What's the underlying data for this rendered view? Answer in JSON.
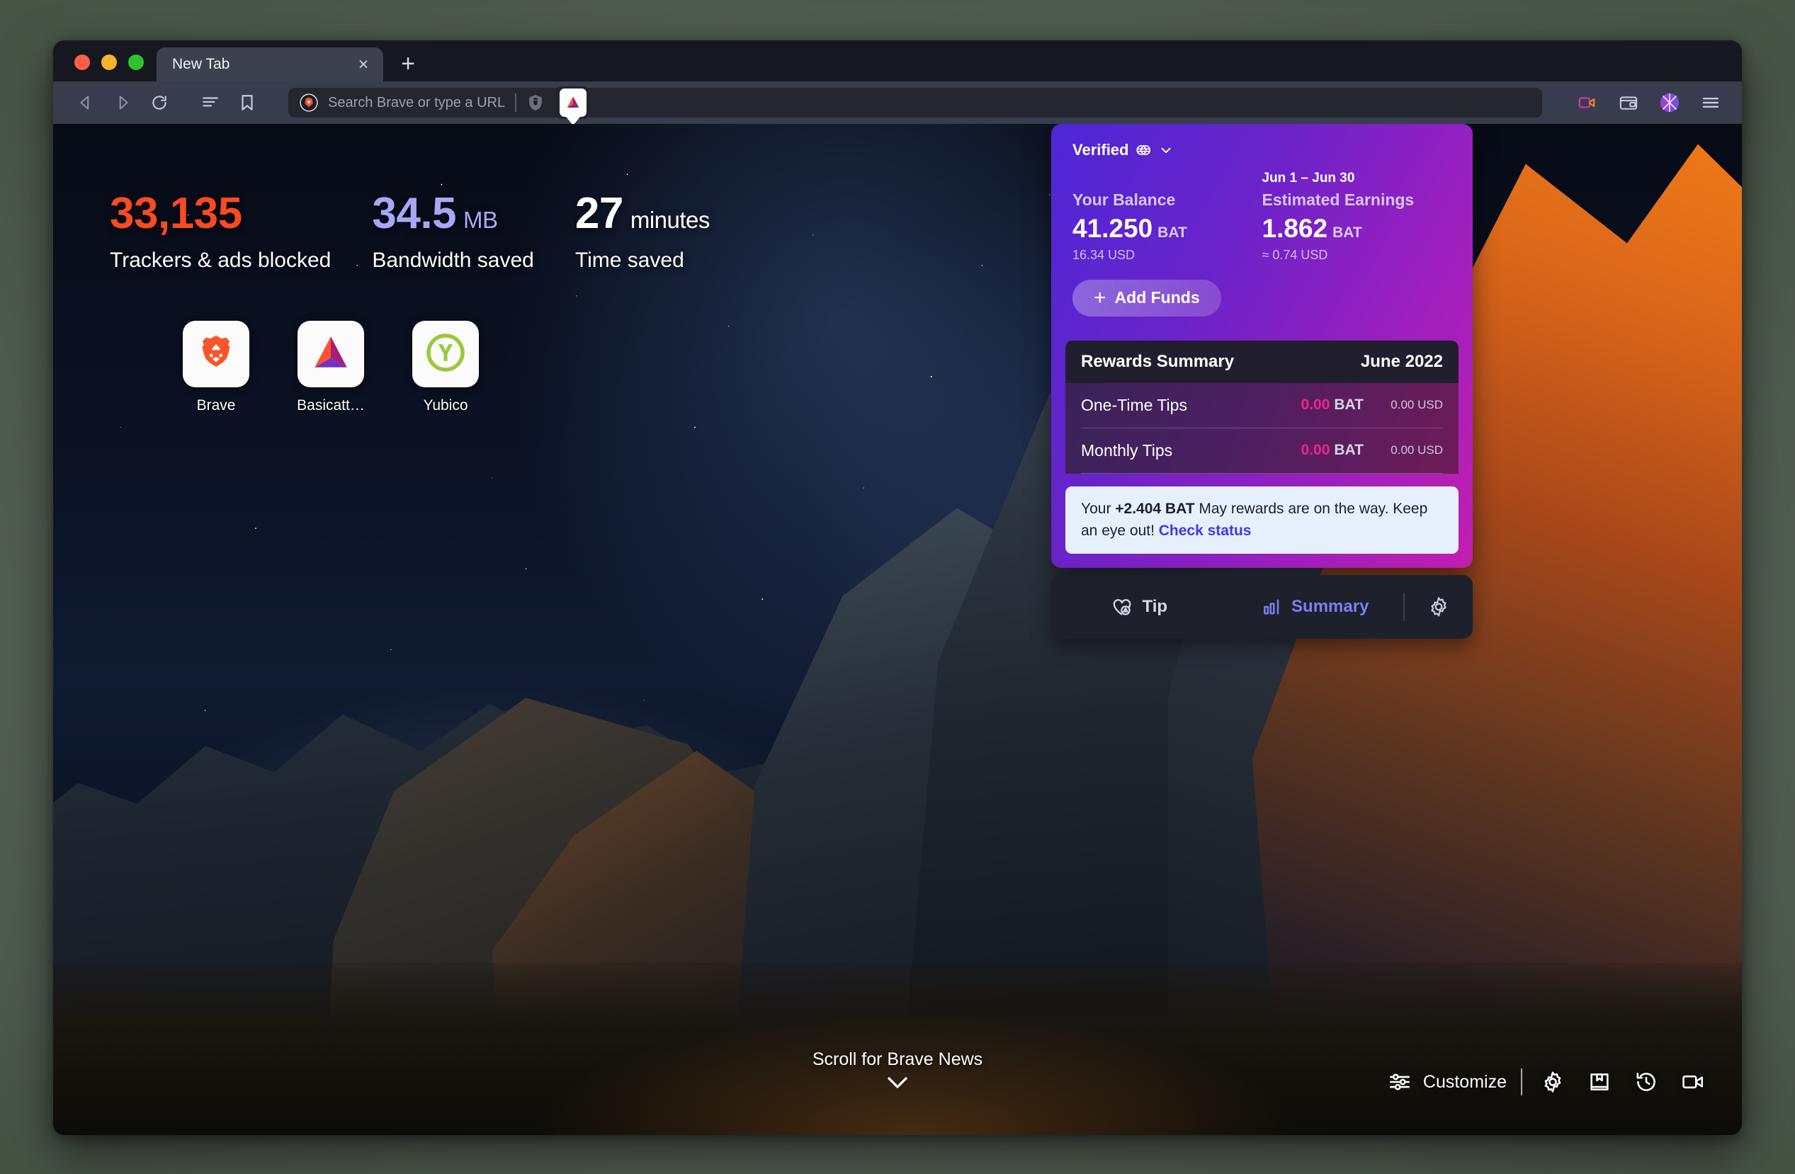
{
  "window": {
    "traffic_lights": [
      "close",
      "minimize",
      "zoom"
    ]
  },
  "tabs": {
    "items": [
      {
        "title": "New Tab",
        "close_label": "×"
      }
    ],
    "new_tab_label": "+"
  },
  "toolbar": {
    "back_icon": "back-arrow-icon",
    "forward_icon": "forward-arrow-icon",
    "reload_icon": "reload-icon",
    "reading_list_icon": "reading-list-icon",
    "bookmark_icon": "bookmark-icon",
    "omnibox": {
      "placeholder": "Search Brave or type a URL",
      "leading_icon": "brave-search-lion-icon",
      "shields_icon": "brave-shields-icon",
      "rewards_icon": "bat-triangle-icon"
    },
    "right_icons": [
      "brave-talk-camera-icon",
      "brave-wallet-icon",
      "brave-profile-avatar-icon",
      "browser-menu-icon"
    ]
  },
  "newtab": {
    "stats": [
      {
        "value": "33,135",
        "unit": "",
        "label": "Trackers & ads blocked",
        "color": "#fa4a21"
      },
      {
        "value": "34.5",
        "unit": "MB",
        "label": "Bandwidth saved",
        "color": "#a6a8f7"
      },
      {
        "value": "27",
        "unit": "minutes",
        "label": "Time saved",
        "color": "#ffffff"
      }
    ],
    "top_sites": [
      {
        "name": "Brave",
        "icon": "brave-lion-icon"
      },
      {
        "name": "Basicatt…",
        "icon": "bat-triangle-icon"
      },
      {
        "name": "Yubico",
        "icon": "yubico-y-icon"
      }
    ],
    "scroll_hint": "Scroll for Brave News",
    "scroll_hint_icon": "chevron-down-icon",
    "controls": {
      "customize_label": "Customize",
      "customize_icon": "sliders-icon",
      "icons": [
        "settings-gear-icon",
        "bookmarks-book-icon",
        "history-clock-icon",
        "brave-talk-camera-icon"
      ]
    }
  },
  "rewards": {
    "status_label": "Verified",
    "status_icon": "gemini-custodian-icon",
    "status_chevron": "chevron-down-icon",
    "balance": {
      "heading": "Your Balance",
      "amount": "41.250",
      "currency": "BAT",
      "usd": "16.34 USD"
    },
    "earnings": {
      "date_range": "Jun 1 – Jun 30",
      "heading": "Estimated Earnings",
      "amount": "1.862",
      "currency": "BAT",
      "usd": "≈ 0.74 USD"
    },
    "add_funds": {
      "label": "Add Funds",
      "icon": "plus-icon"
    },
    "summary": {
      "title": "Rewards Summary",
      "month": "June 2022",
      "rows": [
        {
          "label": "One-Time Tips",
          "bat": "0.00",
          "bat_unit": "BAT",
          "usd": "0.00 USD"
        },
        {
          "label": "Monthly Tips",
          "bat": "0.00",
          "bat_unit": "BAT",
          "usd": "0.00 USD"
        }
      ]
    },
    "notice": {
      "prefix": "Your ",
      "amount": "+2.404 BAT",
      "middle": " May rewards are on the way. Keep an eye out! ",
      "link": "Check status"
    },
    "footer": {
      "tip_label": "Tip",
      "tip_icon": "heart-bat-tip-icon",
      "summary_label": "Summary",
      "summary_icon": "bar-chart-icon",
      "settings_icon": "settings-gear-icon"
    },
    "colors": {
      "gradient_start": "#4d27d6",
      "gradient_end": "#c31fb0",
      "bat_pink": "#f1248a",
      "link_blue": "#4436e8",
      "active_tab": "#7c7ff0"
    }
  }
}
